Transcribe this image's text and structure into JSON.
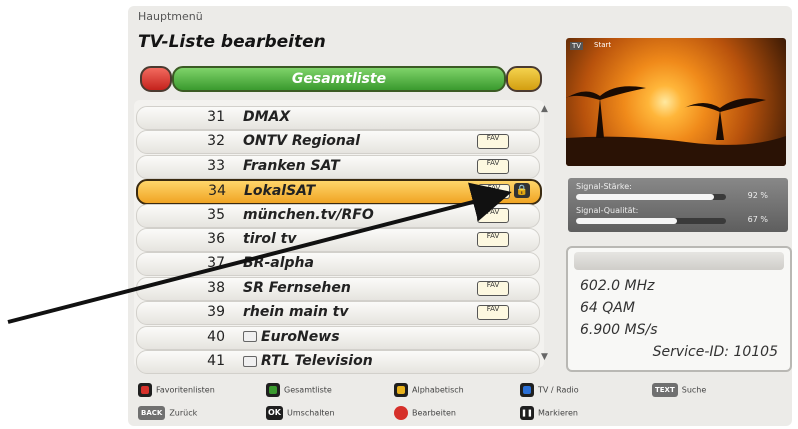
{
  "header": {
    "breadcrumb": "Hauptmenü",
    "title": "TV-Liste bearbeiten"
  },
  "filter_bar": {
    "label": "Gesamtliste"
  },
  "channels": [
    {
      "num": "31",
      "name": "DMAX",
      "fav": false,
      "selected": false,
      "lock": false,
      "icon": false
    },
    {
      "num": "32",
      "name": "ONTV Regional",
      "fav": true,
      "selected": false,
      "lock": false,
      "icon": false
    },
    {
      "num": "33",
      "name": "Franken SAT",
      "fav": true,
      "selected": false,
      "lock": false,
      "icon": false
    },
    {
      "num": "34",
      "name": "LokalSAT",
      "fav": true,
      "selected": true,
      "lock": true,
      "icon": false
    },
    {
      "num": "35",
      "name": "münchen.tv/RFO",
      "fav": true,
      "selected": false,
      "lock": false,
      "icon": false
    },
    {
      "num": "36",
      "name": "tirol tv",
      "fav": true,
      "selected": false,
      "lock": false,
      "icon": false
    },
    {
      "num": "37",
      "name": "BR-alpha",
      "fav": false,
      "selected": false,
      "lock": false,
      "icon": false
    },
    {
      "num": "38",
      "name": "SR Fernsehen",
      "fav": true,
      "selected": false,
      "lock": false,
      "icon": false
    },
    {
      "num": "39",
      "name": "rhein main tv",
      "fav": true,
      "selected": false,
      "lock": false,
      "icon": false
    },
    {
      "num": "40",
      "name": "EuroNews",
      "fav": false,
      "selected": false,
      "lock": false,
      "icon": true
    },
    {
      "num": "41",
      "name": "RTL Television",
      "fav": false,
      "selected": false,
      "lock": false,
      "icon": true
    }
  ],
  "fav_label": "FAV",
  "preview": {
    "tag": "TV",
    "channel": "Start"
  },
  "signal": {
    "strength_label": "Signal-Stärke:",
    "strength_value": "92 %",
    "strength_fraction": 0.92,
    "quality_label": "Signal-Qualität:",
    "quality_value": "67 %",
    "quality_fraction": 0.67
  },
  "tuning": {
    "frequency": "602.0 MHz",
    "modulation": "64 QAM",
    "symbol_rate": "6.900 MS/s",
    "service_id": "Service-ID: 10105"
  },
  "legend": {
    "red": "Favoritenlisten",
    "green": "Gesamtliste",
    "yellow": "Alphabetisch",
    "blue": "TV / Radio",
    "text_key": "TEXT",
    "text_label": "Suche",
    "back_key": "BACK",
    "back_label": "Zurück",
    "ok_key": "OK",
    "ok_label": "Umschalten",
    "record_label": "Bearbeiten",
    "pause_label": "Markieren"
  },
  "colors": {
    "accent_green": "#3a9a2e",
    "selection_orange": "#f0a424",
    "red": "#d6302a",
    "yellow": "#e8b21c",
    "blue": "#2a6fd6"
  }
}
